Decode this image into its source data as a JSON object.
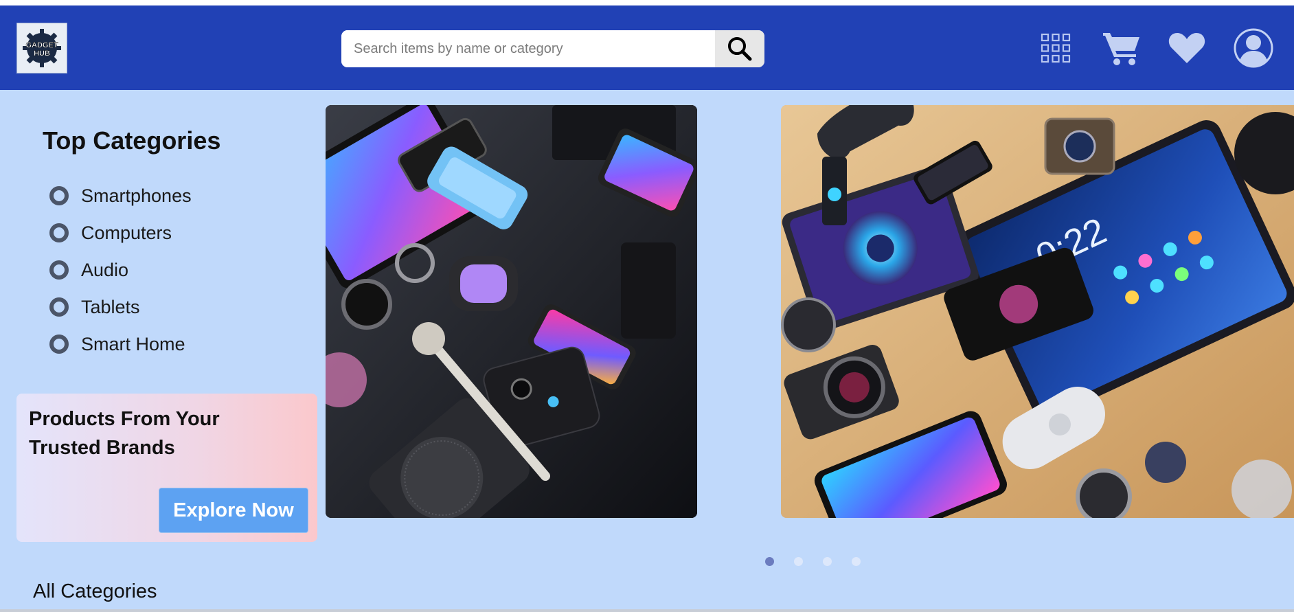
{
  "header": {
    "logo_text": "GADGET HUB",
    "search": {
      "placeholder": "Search items by name or category",
      "value": ""
    },
    "icons": [
      "grid-menu-icon",
      "cart-icon",
      "heart-icon",
      "user-icon"
    ]
  },
  "sidebar": {
    "title": "Top Categories",
    "categories": [
      {
        "label": "Smartphones"
      },
      {
        "label": "Computers"
      },
      {
        "label": "Audio"
      },
      {
        "label": "Tablets"
      },
      {
        "label": "Smart Home"
      }
    ]
  },
  "promo": {
    "title": "Products From Your Trusted Brands",
    "button_label": "Explore Now"
  },
  "carousel": {
    "slides": [
      "gadgets-dark-photo",
      "gadgets-wood-photo"
    ],
    "dots": 4,
    "active_index": 0
  },
  "sections": {
    "all_categories_label": "All Categories"
  },
  "colors": {
    "header_bg": "#2141b5",
    "page_bg": "#c0d9fb",
    "button_bg": "#5da2f2",
    "dot_active": "#6b7cbf",
    "dot_inactive": "#dde8fb"
  }
}
